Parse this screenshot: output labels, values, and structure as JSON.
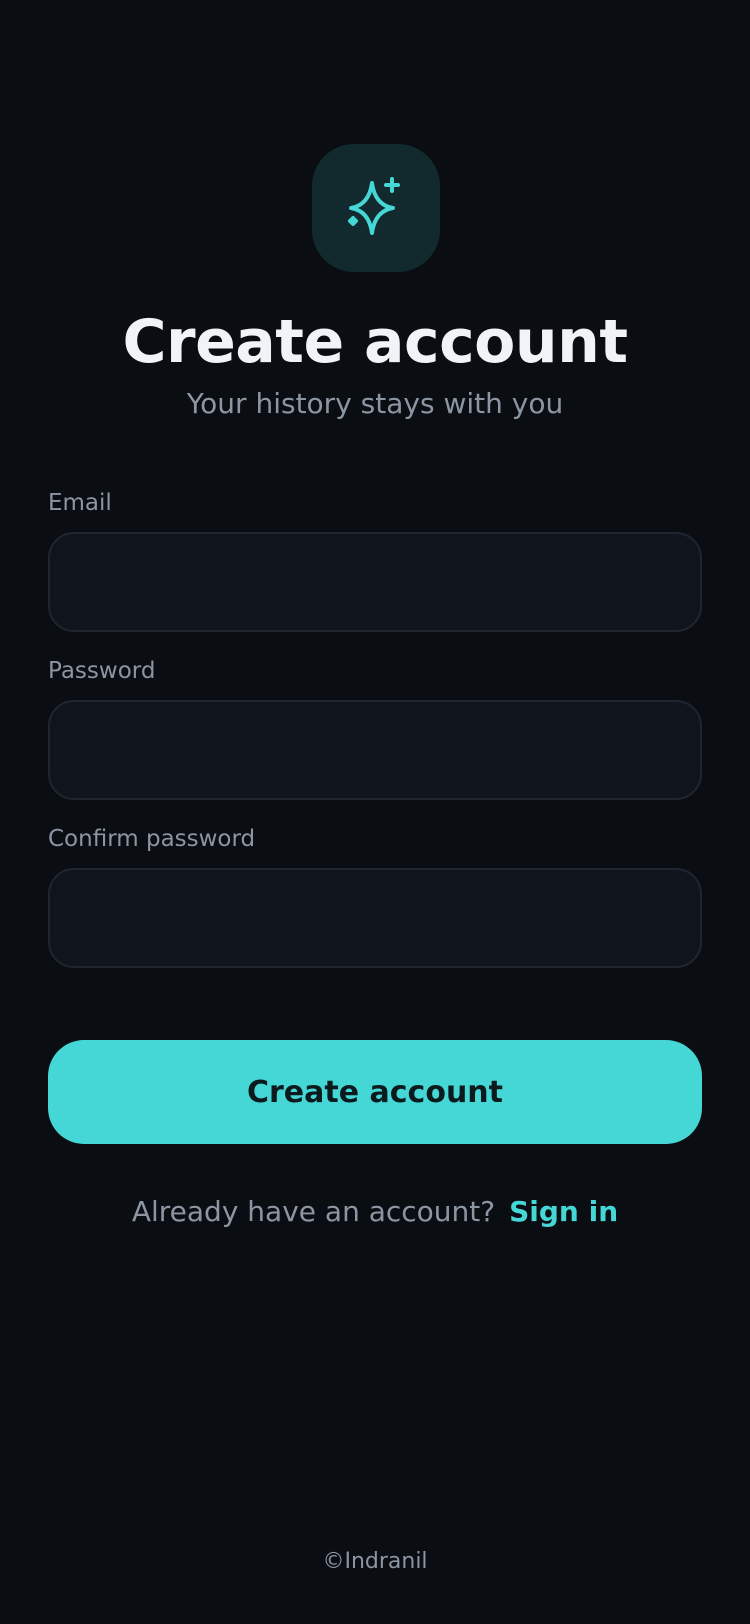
{
  "app": {
    "logo_icon": "sparkles-icon",
    "accent_color": "#45d6d6",
    "background_color": "#0a0d12"
  },
  "header": {
    "title": "Create account",
    "subtitle": "Your history stays with you"
  },
  "form": {
    "email_label": "Email",
    "email_value": "",
    "password_label": "Password",
    "password_value": "",
    "confirm_label": "Confirm password",
    "confirm_value": "",
    "submit_label": "Create account"
  },
  "signin": {
    "prompt": "Already have an account?",
    "link_label": "Sign in"
  },
  "footer": {
    "text": "©Indranil"
  }
}
